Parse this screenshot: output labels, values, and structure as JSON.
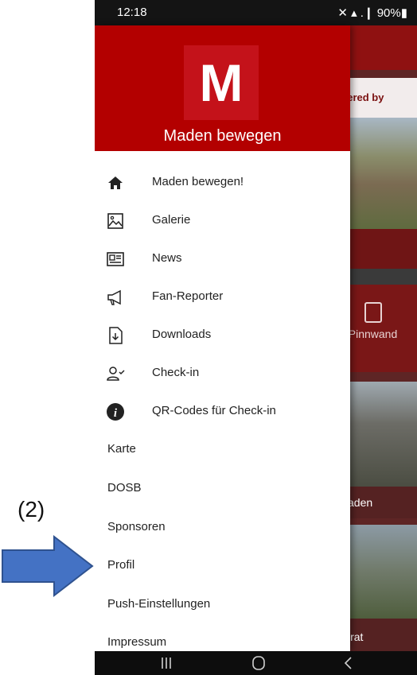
{
  "status_bar": {
    "time": "12:18",
    "icons_text": "✕ ▴ .❙ 90%▮"
  },
  "background_app": {
    "powered_text": "vered by",
    "tile_label": "Pinnwand",
    "label_1": "aden",
    "label_2": "irat"
  },
  "drawer": {
    "logo_letter": "M",
    "app_name": "Maden bewegen",
    "items_with_icons": [
      {
        "label": "Maden bewegen!",
        "icon": "home-icon"
      },
      {
        "label": "Galerie",
        "icon": "image-icon"
      },
      {
        "label": "News",
        "icon": "newspaper-icon"
      },
      {
        "label": "Fan-Reporter",
        "icon": "megaphone-icon"
      },
      {
        "label": "Downloads",
        "icon": "download-file-icon"
      },
      {
        "label": "Check-in",
        "icon": "user-check-icon"
      },
      {
        "label": "QR-Codes für Check-in",
        "icon": "info-icon"
      }
    ],
    "items_plain": [
      {
        "label": "Karte"
      },
      {
        "label": "DOSB"
      },
      {
        "label": "Sponsoren"
      },
      {
        "label": "Profil"
      },
      {
        "label": "Push-Einstellungen"
      },
      {
        "label": "Impressum"
      }
    ]
  },
  "annotation": {
    "label": "(2)",
    "arrow_color": "#4472c4"
  },
  "colors": {
    "brand_red": "#b30000",
    "logo_red": "#c4121a",
    "arrow_blue": "#4472c4"
  }
}
